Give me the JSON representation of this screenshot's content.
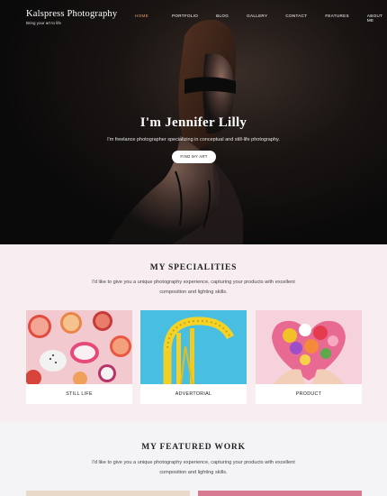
{
  "header": {
    "brand_name": "Kalspress Photography",
    "brand_tagline": "Bring your art to life",
    "nav": [
      "HOME",
      "PORTFOLIO",
      "BLOG",
      "GALLERY",
      "CONTACT",
      "FEATURES",
      "ABOUT ME"
    ],
    "active_nav": "HOME"
  },
  "hero": {
    "title": "I'm Jennifer Lilly",
    "subtitle": "I'm freelance photographer specializing in conceptual and still-life photography.",
    "button": "FIND MY ART"
  },
  "specialities": {
    "title": "MY SPECIALITIES",
    "text": "I'd like to give you a unique photography experience, capturing your products with excellent composition and lighting skills.",
    "cards": [
      {
        "label": "STILL LIFE"
      },
      {
        "label": "ADVERTORIAL"
      },
      {
        "label": "PRODUCT"
      }
    ]
  },
  "featured": {
    "title": "MY FEATURED WORK",
    "text": "I'd like to give you a unique photography experience, capturing your products with excellent composition and lighting skills."
  },
  "colors": {
    "accent": "#e8a06a",
    "spec_bg": "#f8eef2",
    "feat_bg": "#f4f4f6"
  }
}
